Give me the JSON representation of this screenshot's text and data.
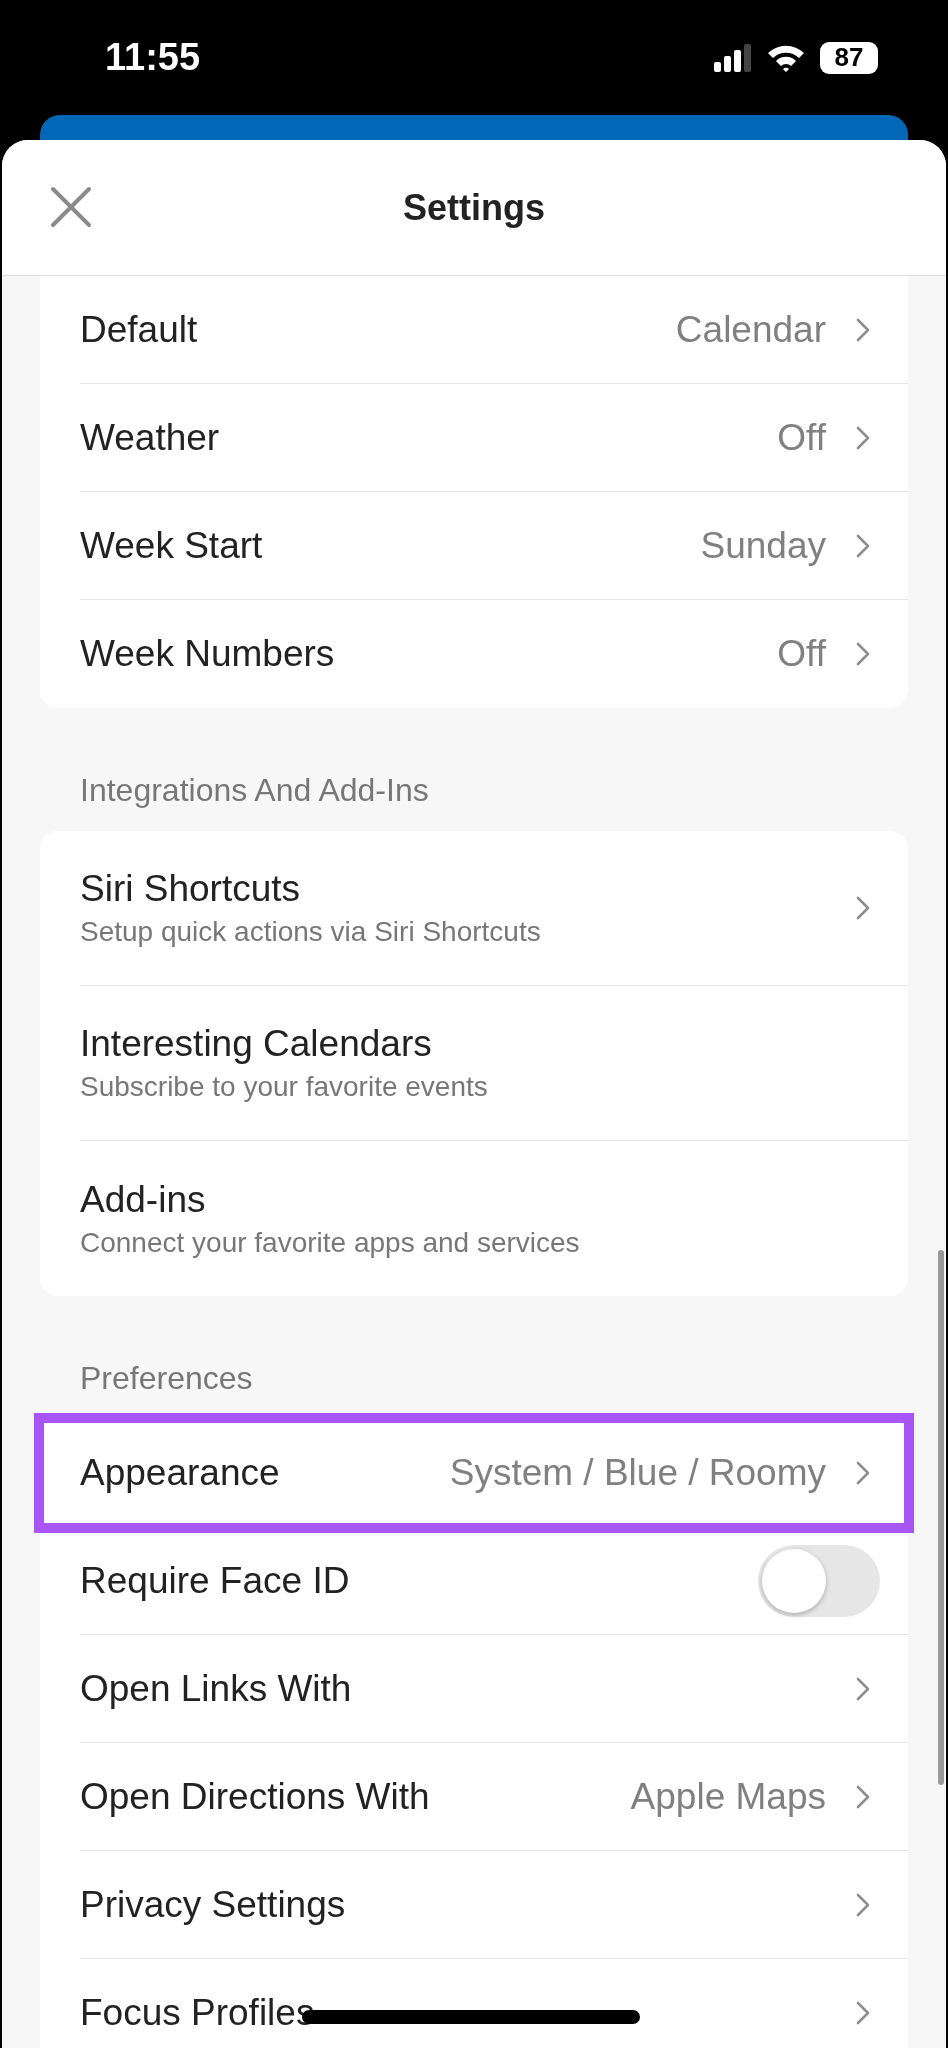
{
  "status_bar": {
    "time": "11:55",
    "battery": "87"
  },
  "header": {
    "title": "Settings"
  },
  "sections": [
    {
      "items": [
        {
          "kind": "value",
          "title": "Default",
          "value": "Calendar",
          "highlighted": false
        },
        {
          "kind": "value",
          "title": "Weather",
          "value": "Off",
          "highlighted": false
        },
        {
          "kind": "value",
          "title": "Week Start",
          "value": "Sunday",
          "highlighted": false
        },
        {
          "kind": "value",
          "title": "Week Numbers",
          "value": "Off",
          "highlighted": false
        }
      ]
    },
    {
      "heading": "Integrations And Add-Ins",
      "items": [
        {
          "kind": "subtitle",
          "title": "Siri Shortcuts",
          "subtitle": "Setup quick actions via Siri Shortcuts",
          "chevron": true,
          "highlighted": false
        },
        {
          "kind": "subtitle",
          "title": "Interesting Calendars",
          "subtitle": "Subscribe to your favorite events",
          "chevron": false,
          "highlighted": false
        },
        {
          "kind": "subtitle",
          "title": "Add-ins",
          "subtitle": "Connect your favorite apps and services",
          "chevron": false,
          "highlighted": false
        }
      ]
    },
    {
      "heading": "Preferences",
      "items": [
        {
          "kind": "value",
          "title": "Appearance",
          "value": "System / Blue / Roomy",
          "highlighted": true
        },
        {
          "kind": "toggle",
          "title": "Require Face ID",
          "on": false,
          "highlighted": false
        },
        {
          "kind": "value",
          "title": "Open Links With",
          "highlighted": false
        },
        {
          "kind": "value",
          "title": "Open Directions With",
          "value": "Apple Maps",
          "highlighted": false
        },
        {
          "kind": "value",
          "title": "Privacy Settings",
          "highlighted": false
        },
        {
          "kind": "value",
          "title": "Focus Profiles",
          "highlighted": false
        }
      ]
    }
  ]
}
